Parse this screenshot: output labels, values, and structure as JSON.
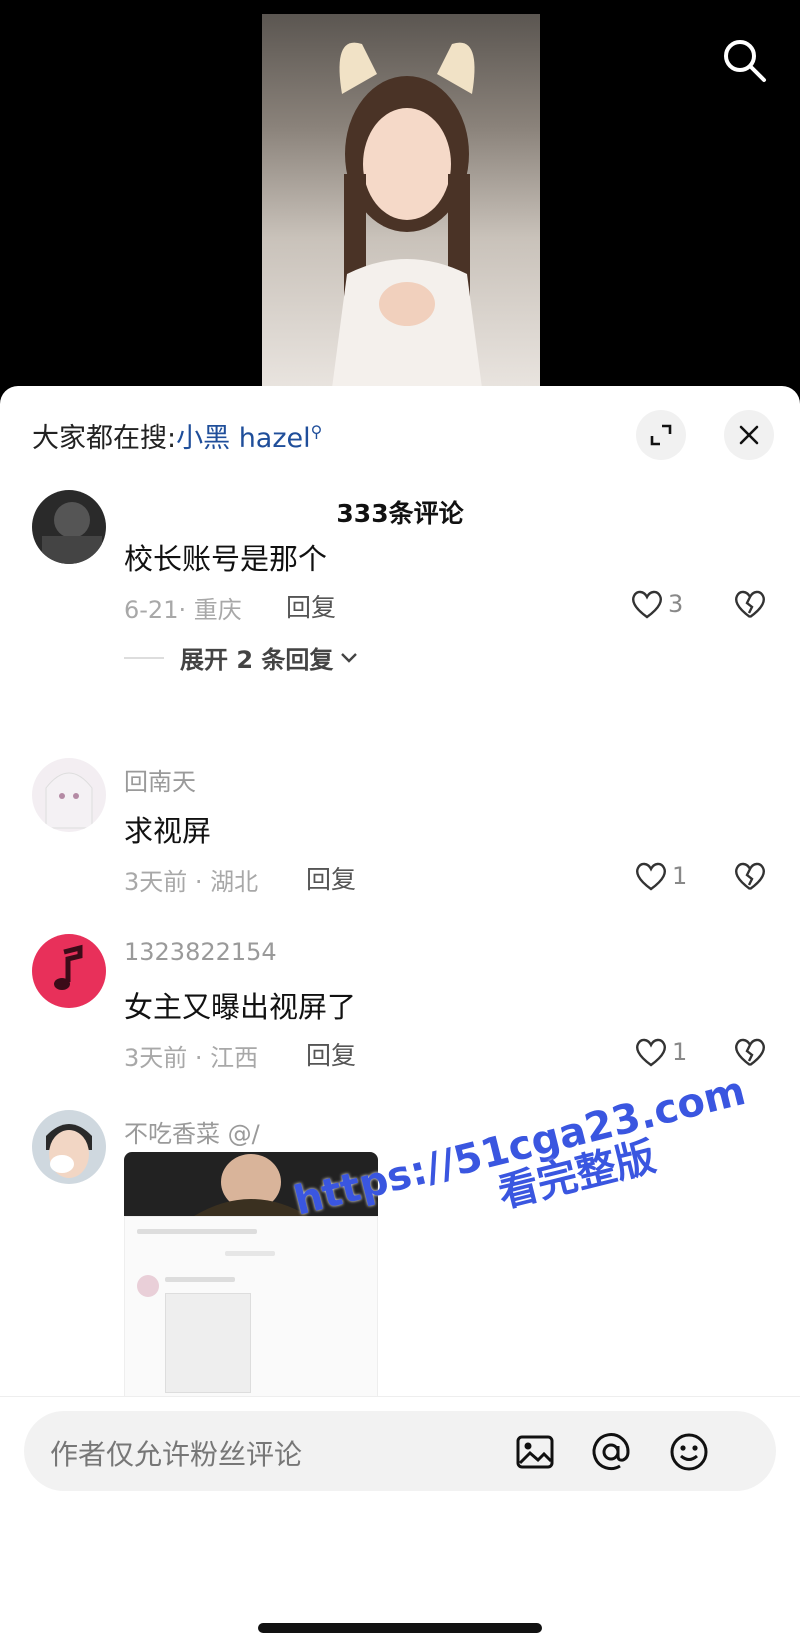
{
  "hot_search": {
    "prefix": "大家都在搜:",
    "term": "小黑 hazel",
    "mag_glyph": "⚲"
  },
  "comments_count_title": "333条评论",
  "comments": [
    {
      "text": "校长账号是那个",
      "date": "6-21",
      "location": "· 重庆",
      "reply_label": "回复",
      "likes": "3",
      "expand_label": "展开 2 条回复"
    },
    {
      "name": "回南天",
      "text": "求视屏",
      "date": "3天前",
      "location": "· 湖北",
      "reply_label": "回复",
      "likes": "1"
    },
    {
      "name": "1323822154",
      "text": "女主又曝出视屏了",
      "date": "3天前",
      "location": "· 江西",
      "reply_label": "回复",
      "likes": "1"
    },
    {
      "name": "不吃香菜 @/"
    }
  ],
  "watermark": {
    "line1": "https://51cga23.com",
    "line2": "看完整版"
  },
  "composer": {
    "placeholder": "作者仅允许粉丝评论"
  },
  "icons": {
    "top_search": "search-icon",
    "expand": "expand-icon",
    "close": "close-icon",
    "like": "heart-icon",
    "dislike": "broken-heart-icon",
    "image": "image-icon",
    "mention": "at-icon",
    "emoji": "emoji-icon"
  },
  "colors": {
    "accent_link": "#1f4e9a",
    "watermark": "#3a56e0",
    "music_avatar": "#e8305a"
  }
}
